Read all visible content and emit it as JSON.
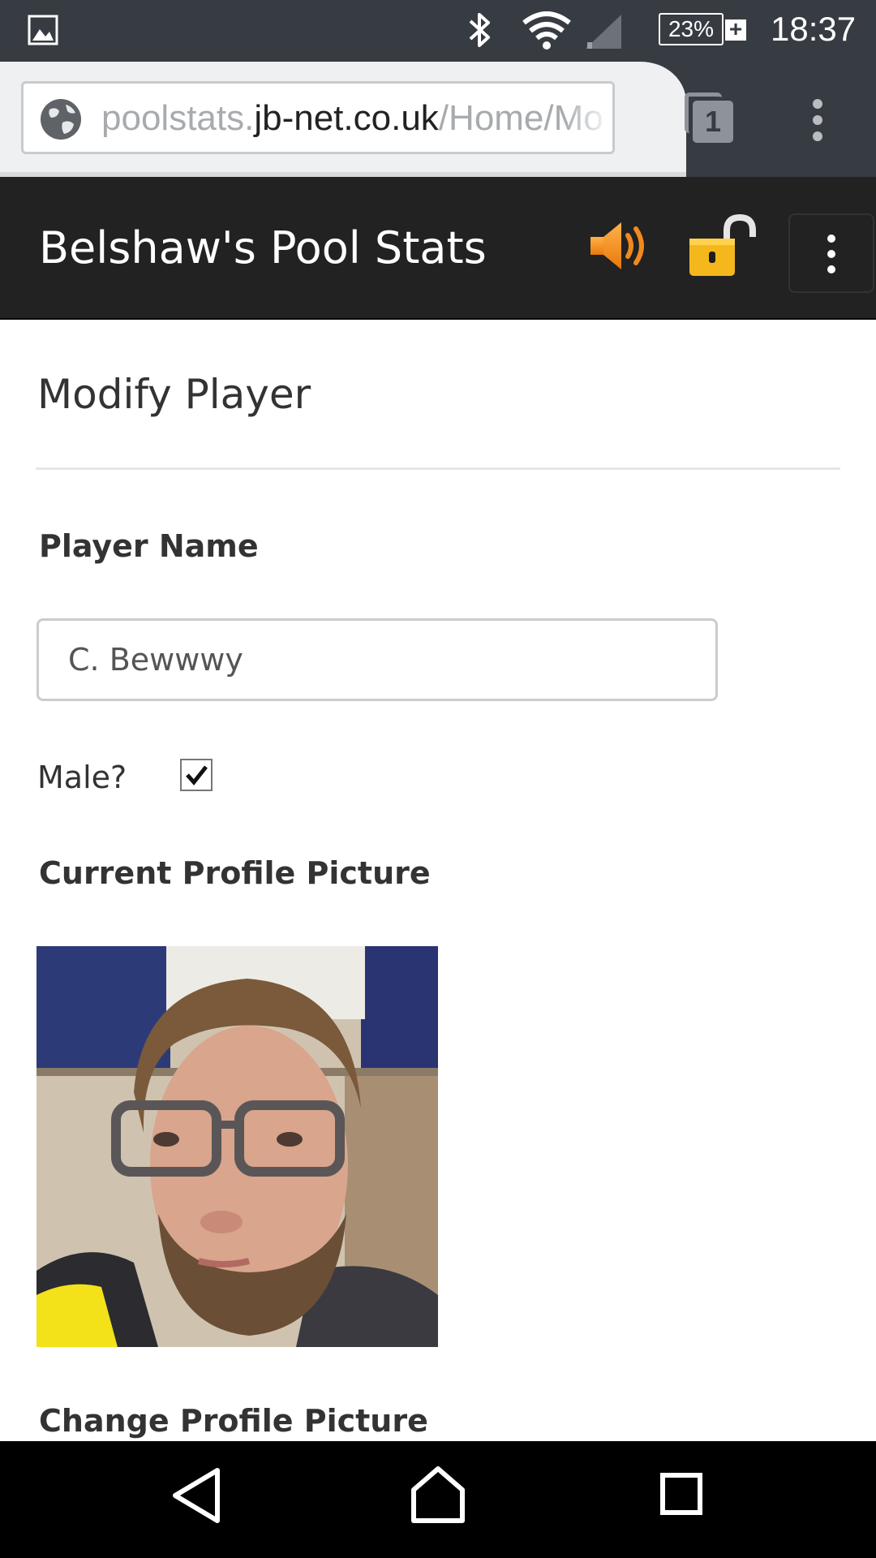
{
  "status_bar": {
    "battery_percent": "23%",
    "battery_plus": "+",
    "time": "18:37",
    "icons": [
      "gallery-icon",
      "bluetooth-icon",
      "wifi-icon",
      "signal-icon",
      "battery-icon"
    ]
  },
  "browser": {
    "url_prefix": "poolstats.",
    "url_host": "jb-net.co.uk",
    "url_path": "/Home/Mo",
    "tab_count": "1",
    "icons": [
      "globe-icon",
      "tabs-icon",
      "overflow-menu-icon"
    ]
  },
  "navbar": {
    "brand": "Belshaw's Pool Stats",
    "icons": [
      "speaker-icon",
      "unlocked-padlock-icon",
      "menu-toggle-icon"
    ],
    "colors": {
      "background": "#222222",
      "icon_accent": "#f5a623"
    }
  },
  "page": {
    "title": "Modify Player",
    "player_name_label": "Player Name",
    "player_name_value": "C. Bewwwy",
    "male_label": "Male?",
    "male_checked": true,
    "current_picture_label": "Current Profile Picture",
    "change_picture_label": "Change Profile Picture"
  },
  "android_nav": {
    "icons": [
      "back-icon",
      "home-icon",
      "recents-icon"
    ]
  }
}
